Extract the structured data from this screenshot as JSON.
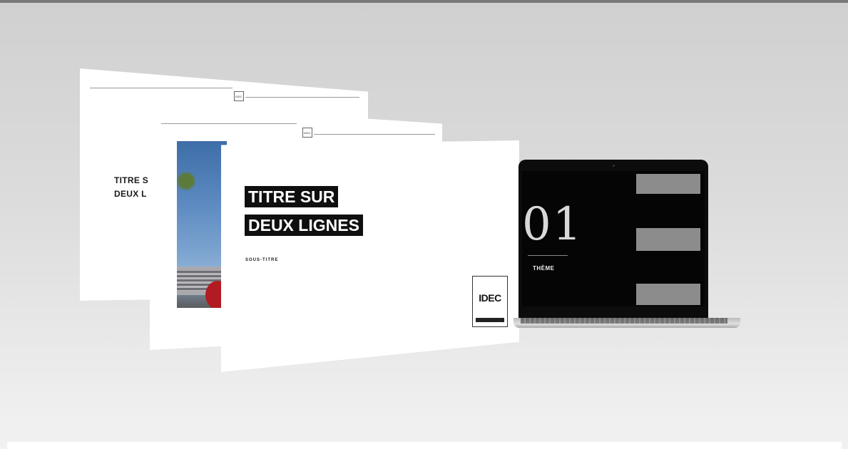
{
  "slides": {
    "back": {
      "logo": "IDEC",
      "title_lines": [
        "TITRE S",
        "DEUX L"
      ]
    },
    "middle": {
      "logo": "IDEC"
    },
    "front": {
      "title_lines": [
        "TITRE SUR",
        "DEUX LIGNES"
      ],
      "subtitle": "SOUS-TITRE",
      "logo": "IDEC"
    }
  },
  "laptop": {
    "number": "01",
    "label": "THÈME"
  },
  "colors": {
    "title_bg": "#0f0f0f",
    "laptop_screen": "#050505",
    "gray_block": "#8c8c8c"
  }
}
